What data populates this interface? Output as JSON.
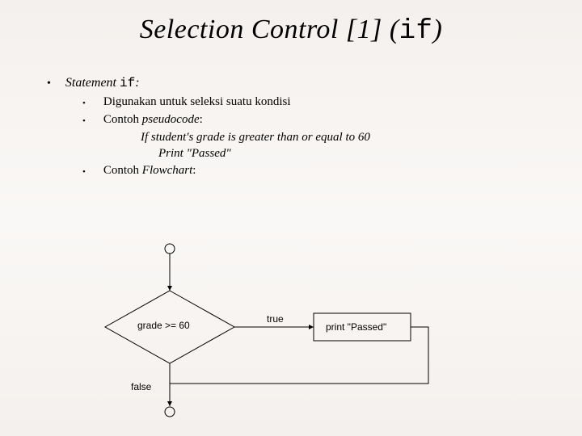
{
  "title": {
    "prefix": "Selection Control ",
    "bracket": "[1] (",
    "mono": "if",
    "suffix": ")"
  },
  "l1": {
    "label_prefix": "Statement ",
    "label_mono": "if",
    "label_suffix": ":"
  },
  "sub1": "Digunakan untuk seleksi suatu kondisi",
  "sub2": {
    "prefix": "Contoh ",
    "italic": "pseudocode",
    "suffix": ":"
  },
  "pseudo": {
    "line1": "If student's grade is greater than or equal to 60",
    "line2": "Print \"Passed\""
  },
  "sub3": {
    "prefix": "Contoh ",
    "italic": "Flowchart",
    "suffix": ":"
  },
  "flow": {
    "condition": "grade >= 60",
    "true_label": "true",
    "false_label": "false",
    "action": "print \"Passed\""
  }
}
